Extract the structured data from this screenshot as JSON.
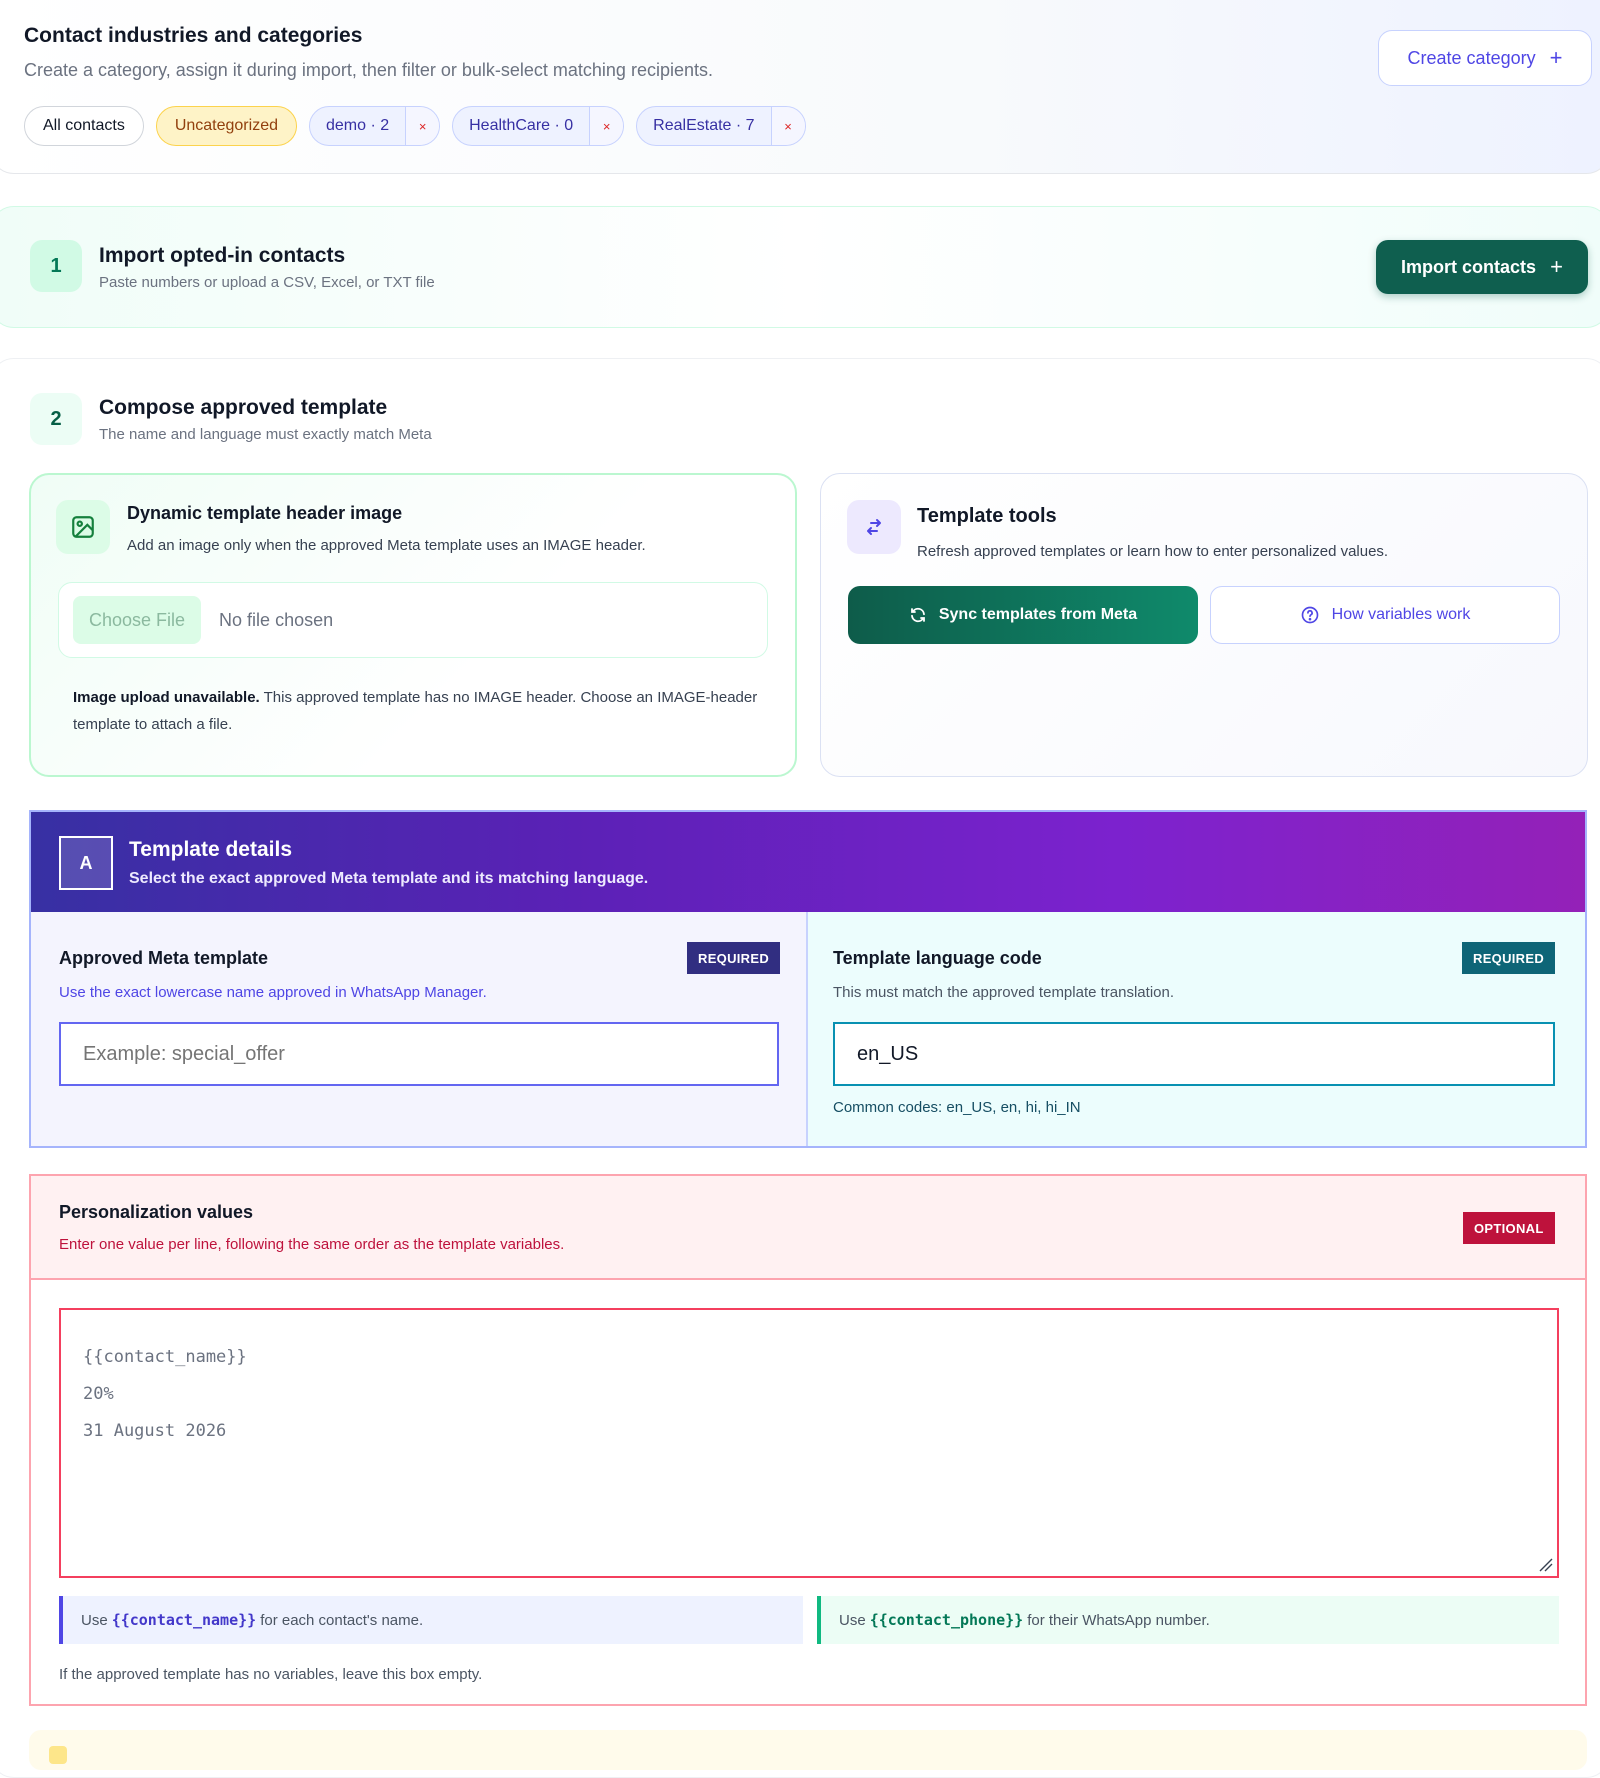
{
  "categories": {
    "title": "Contact industries and categories",
    "subtitle": "Create a category, assign it during import, then filter or bulk-select matching recipients.",
    "create_button": "Create category",
    "chips": {
      "all": "All contacts",
      "uncategorized": "Uncategorized",
      "tags": [
        {
          "label": "demo · 2"
        },
        {
          "label": "HealthCare · 0"
        },
        {
          "label": "RealEstate · 7"
        }
      ],
      "remove_symbol": "×"
    }
  },
  "step1": {
    "number": "1",
    "title": "Import opted-in contacts",
    "subtitle": "Paste numbers or upload a CSV, Excel, or TXT file",
    "import_button": "Import contacts"
  },
  "step2": {
    "number": "2",
    "title": "Compose approved template",
    "subtitle": "The name and language must exactly match Meta"
  },
  "header_image": {
    "title": "Dynamic template header image",
    "subtitle": "Add an image only when the approved Meta template uses an IMAGE header.",
    "choose_file": "Choose File",
    "no_file": "No file chosen",
    "unavailable_bold": "Image upload unavailable.",
    "unavailable_text": "This approved template has no IMAGE header. Choose an IMAGE-header template to attach a file."
  },
  "template_tools": {
    "title": "Template tools",
    "subtitle": "Refresh approved templates or learn how to enter personalized values.",
    "sync_button": "Sync templates from Meta",
    "how_button": "How variables work"
  },
  "template_details": {
    "badge": "A",
    "title": "Template details",
    "subtitle": "Select the exact approved Meta template and its matching language.",
    "meta_template": {
      "label": "Approved Meta template",
      "badge": "REQUIRED",
      "help": "Use the exact lowercase name approved in WhatsApp Manager.",
      "placeholder": "Example: special_offer",
      "value": ""
    },
    "language": {
      "label": "Template language code",
      "badge": "REQUIRED",
      "help": "This must match the approved template translation.",
      "value": "en_US",
      "common": "Common codes: en_US, en, hi, hi_IN"
    }
  },
  "personalization": {
    "title": "Personalization values",
    "subtitle": "Enter one value per line, following the same order as the template variables.",
    "badge": "OPTIONAL",
    "lines": [
      "{{contact_name}}",
      "20%",
      "31 August 2026"
    ],
    "hint_name_pre": "Use",
    "hint_name_code": "{{contact_name}}",
    "hint_name_post": "for each contact's name.",
    "hint_phone_pre": "Use",
    "hint_phone_code": "{{contact_phone}}",
    "hint_phone_post": "for their WhatsApp number.",
    "footer": "If the approved template has no variables, leave this box empty."
  },
  "colors": {
    "primary": "#4f46e5",
    "success_dark": "#0f5f4f",
    "danger": "#be123c",
    "indigo_dark": "#312e81",
    "teal": "#0e6577"
  }
}
